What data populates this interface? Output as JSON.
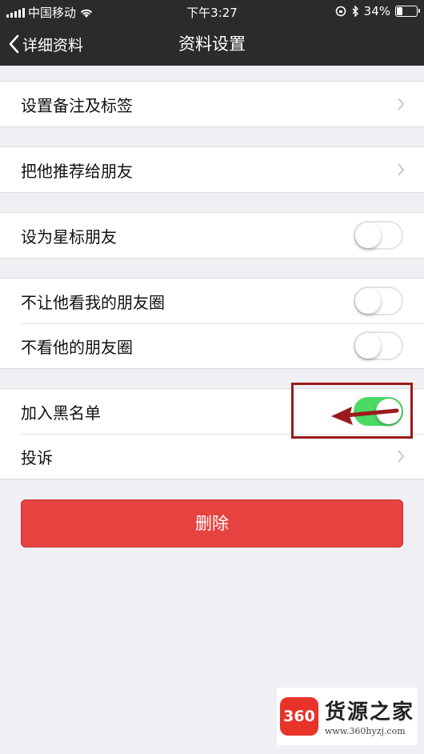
{
  "status_bar": {
    "carrier": "中国移动",
    "time": "下午3:27",
    "battery": "34%",
    "battery_level": 0.34
  },
  "nav": {
    "back_label": "详细资料",
    "title": "资料设置"
  },
  "rows": {
    "remark": {
      "label": "设置备注及标签"
    },
    "recommend": {
      "label": "把他推荐给朋友"
    },
    "star": {
      "label": "设为星标朋友",
      "on": false
    },
    "hide_moments": {
      "label": "不让他看我的朋友圈",
      "on": false
    },
    "not_view": {
      "label": "不看他的朋友圈",
      "on": false
    },
    "blacklist": {
      "label": "加入黑名单",
      "on": true
    },
    "report": {
      "label": "投诉"
    }
  },
  "delete_label": "删除",
  "watermark": {
    "logo": "360",
    "title": "货源之家",
    "url": "www.360hyzj.com"
  },
  "colors": {
    "nav_bg": "#2b2b2e",
    "switch_on": "#4cd964",
    "delete": "#e64340",
    "annotation": "#9b1b1b"
  }
}
